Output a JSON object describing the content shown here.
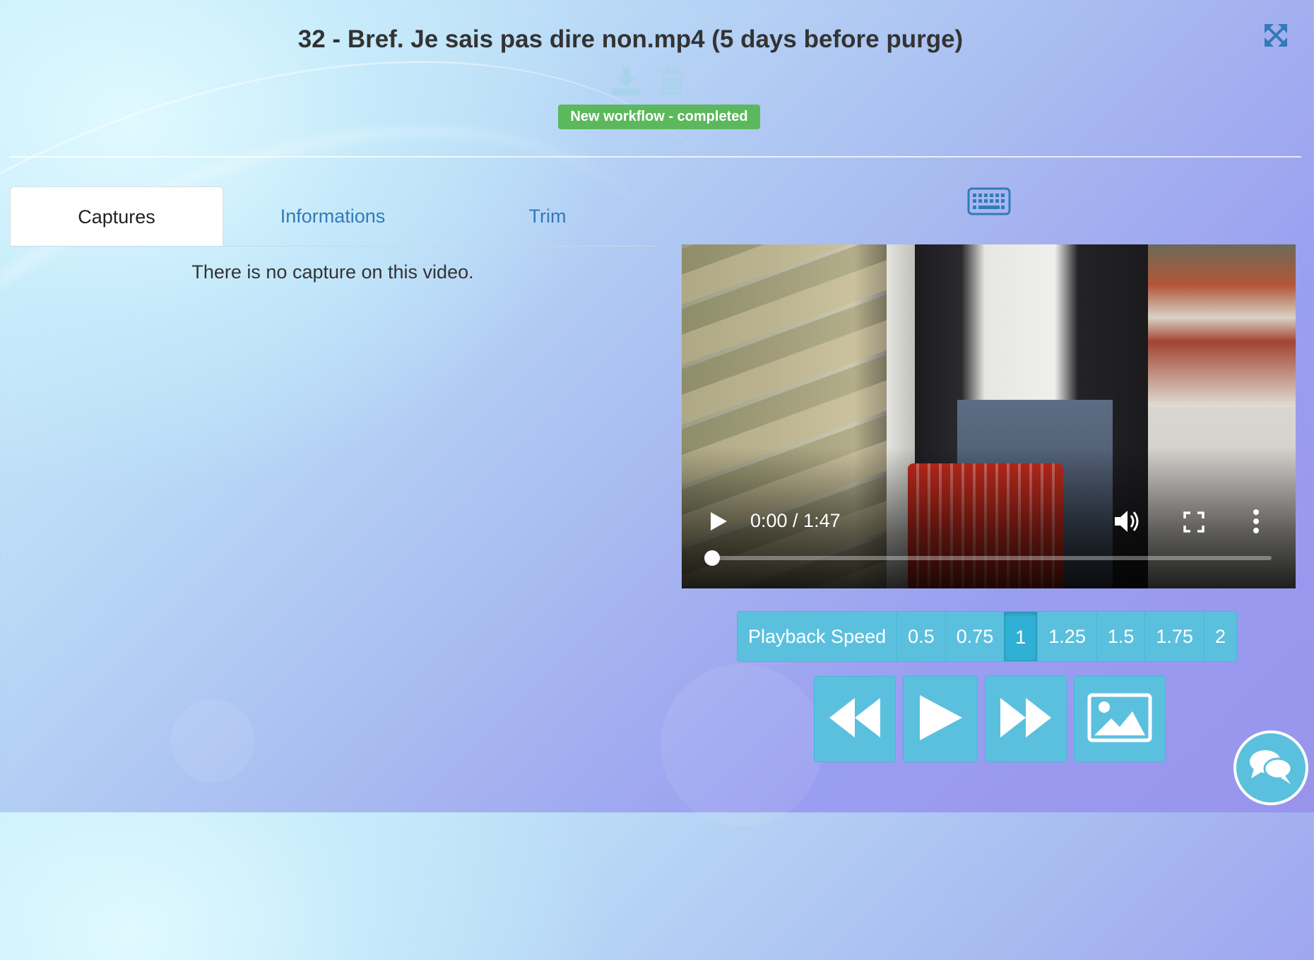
{
  "header": {
    "title": "32 - Bref. Je sais pas dire non.mp4 (5 days before purge)",
    "status_badge": "New workflow - completed",
    "badge_color": "#5cb85c",
    "icons": [
      "download-icon",
      "trash-icon",
      "expand-icon"
    ]
  },
  "tabs": [
    {
      "label": "Captures",
      "active": true
    },
    {
      "label": "Informations",
      "active": false
    },
    {
      "label": "Trim",
      "active": false
    }
  ],
  "captures": {
    "empty_message": "There is no capture on this video."
  },
  "video": {
    "time_display": "0:00 / 1:47",
    "progress": 0.0
  },
  "playback_speed": {
    "label": "Playback Speed",
    "options": [
      "0.5",
      "0.75",
      "1",
      "1.25",
      "1.5",
      "1.75",
      "2"
    ],
    "selected": "1"
  },
  "controls": [
    "rewind-icon",
    "play-icon",
    "fast-forward-icon",
    "capture-image-icon"
  ],
  "colors": {
    "accent": "#5bc0de",
    "link": "#337ab7"
  }
}
